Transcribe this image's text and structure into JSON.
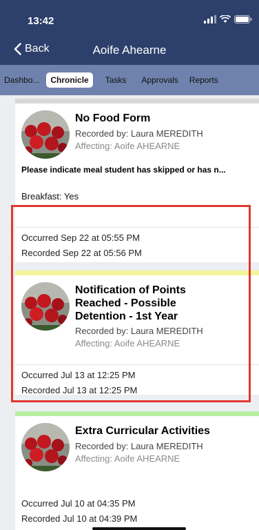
{
  "status": {
    "time": "13:42"
  },
  "nav": {
    "back_label": "Back",
    "title": "Aoife Ahearne"
  },
  "tabs": [
    {
      "label": "Dashbo..."
    },
    {
      "label": "Chronicle",
      "active": true
    },
    {
      "label": "Tasks"
    },
    {
      "label": "Approvals"
    },
    {
      "label": "Reports"
    }
  ],
  "cards": [
    {
      "title": "No Food Form",
      "recorded_by": "Recorded by: Laura MEREDITH",
      "affecting": "Affecting: Aoife AHEARNE",
      "description": "Please indicate meal student has skipped or has n...",
      "detail": "Breakfast: Yes",
      "occurred": "Occurred Sep 22 at 05:55 PM",
      "recorded": "Recorded Sep 22 at 05:56 PM",
      "band_color": "#d8d8d8"
    },
    {
      "title": "Notification of Points Reached - Possible Detention - 1st Year",
      "recorded_by": "Recorded by: Laura MEREDITH",
      "affecting": "Affecting: Aoife AHEARNE",
      "occurred": "Occurred Jul 13 at 12:25 PM",
      "recorded": "Recorded Jul 13 at 12:25 PM",
      "band_color": "#f4f59a"
    },
    {
      "title": "Extra Curricular Activities",
      "recorded_by": "Recorded by: Laura MEREDITH",
      "affecting": "Affecting: Aoife AHEARNE",
      "occurred": "Occurred Jul 10 at 04:35 PM",
      "recorded": "Recorded Jul 10 at 04:39 PM",
      "band_color": "#b9eea2"
    }
  ],
  "colors": {
    "header": "#2d3f6b",
    "tabs": "#6e82ad",
    "highlight": "#e0392e"
  }
}
